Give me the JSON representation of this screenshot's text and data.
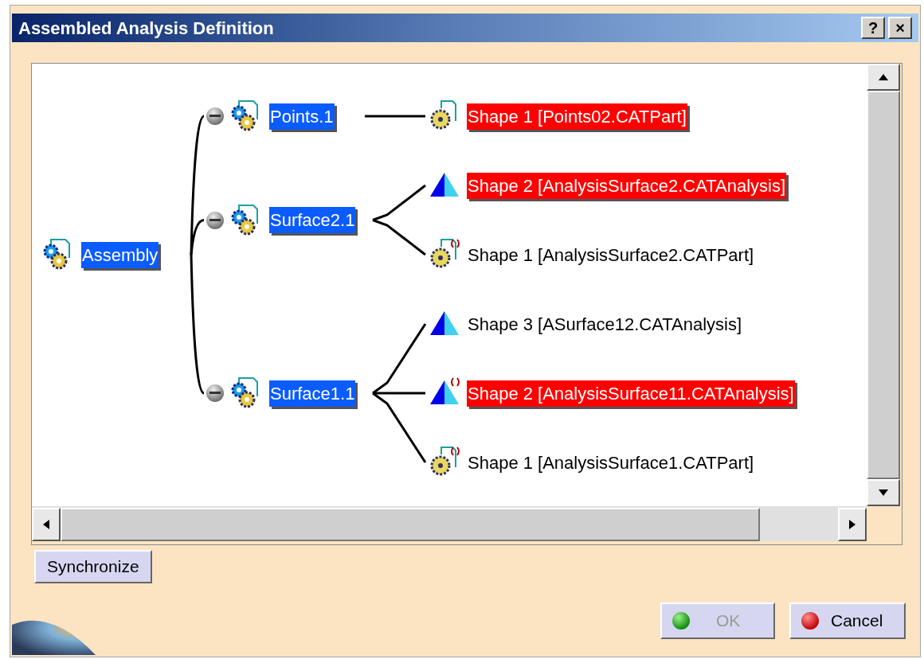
{
  "window": {
    "title": "Assembled Analysis Definition",
    "title_buttons": [
      "?",
      "×"
    ]
  },
  "tree": {
    "label": "Assembly",
    "kind": "product",
    "selected": true,
    "error": false,
    "marked": false,
    "children": [
      {
        "label": "Points.1",
        "kind": "product",
        "selected": true,
        "error": false,
        "marked": false,
        "expanded": true,
        "children": [
          {
            "label": "Shape 1 [Points02.CATPart]",
            "kind": "part",
            "selected": true,
            "error": true,
            "marked": false
          }
        ]
      },
      {
        "label": "Surface2.1",
        "kind": "product",
        "selected": true,
        "error": false,
        "marked": false,
        "expanded": true,
        "children": [
          {
            "label": "Shape 2 [AnalysisSurface2.CATAnalysis]",
            "kind": "analysis",
            "selected": true,
            "error": true,
            "marked": false
          },
          {
            "label": "Shape 1 [AnalysisSurface2.CATPart]",
            "kind": "part",
            "selected": false,
            "error": false,
            "marked": true
          }
        ]
      },
      {
        "label": "Surface1.1",
        "kind": "product",
        "selected": true,
        "error": false,
        "marked": false,
        "expanded": true,
        "children": [
          {
            "label": "Shape 3 [ASurface12.CATAnalysis]",
            "kind": "analysis",
            "selected": false,
            "error": false,
            "marked": false
          },
          {
            "label": "Shape 2 [AnalysisSurface11.CATAnalysis]",
            "kind": "analysis",
            "selected": true,
            "error": true,
            "marked": true
          },
          {
            "label": "Shape 1 [AnalysisSurface1.CATPart]",
            "kind": "part",
            "selected": false,
            "error": false,
            "marked": true
          }
        ]
      }
    ]
  },
  "synchronize_button": "Synchronize",
  "buttons": [
    {
      "kind": "ok",
      "label": "OK",
      "disabled": true
    },
    {
      "kind": "cancel",
      "label": "Cancel",
      "disabled": false
    }
  ]
}
